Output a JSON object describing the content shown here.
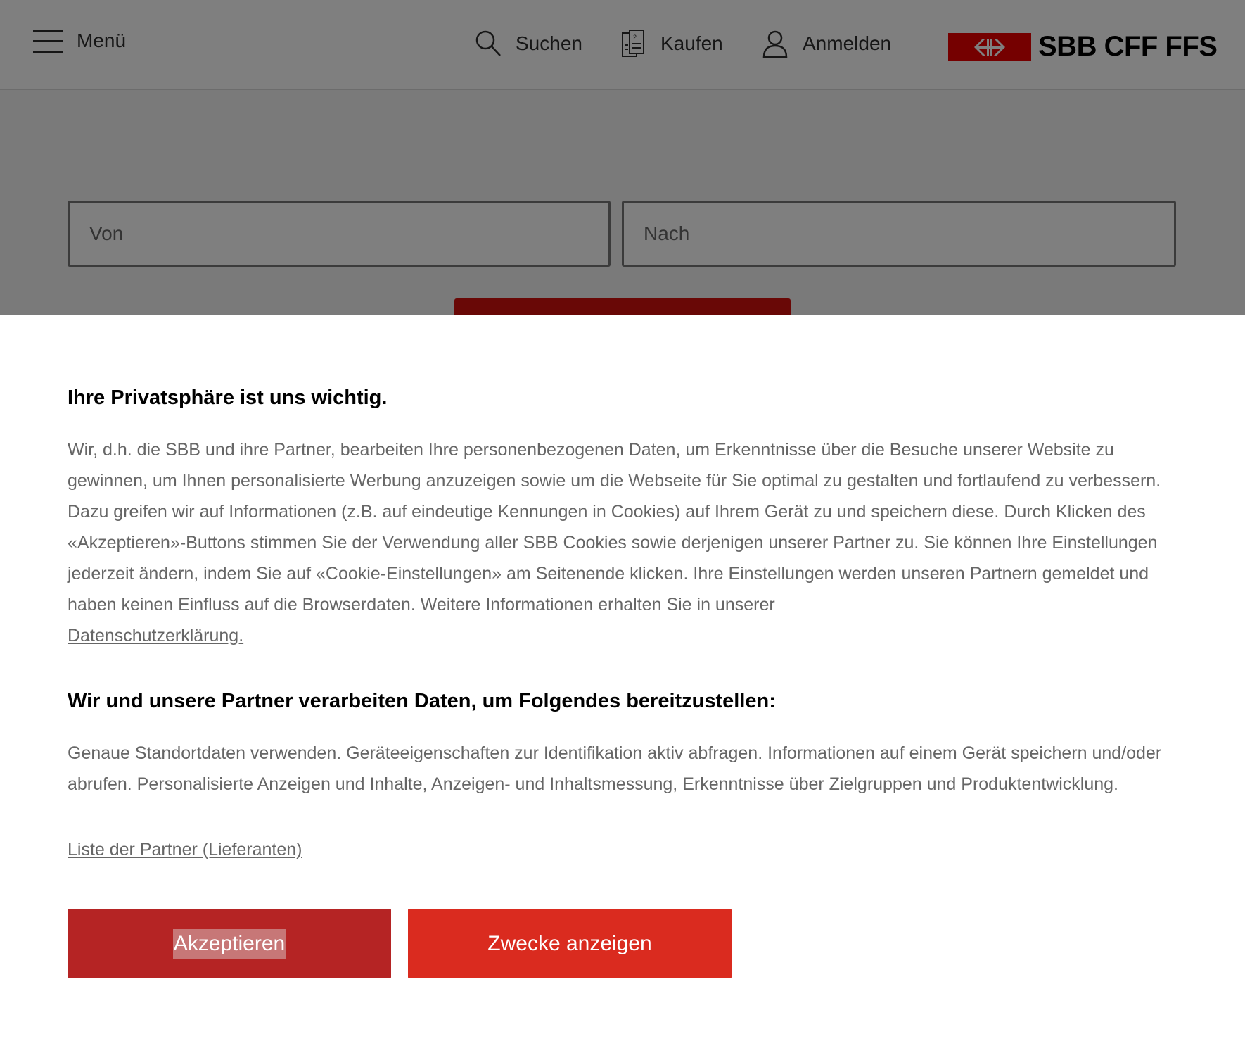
{
  "header": {
    "menu_label": "Menü",
    "nav": {
      "search_label": "Suchen",
      "buy_label": "Kaufen",
      "login_label": "Anmelden"
    },
    "logo_text": "SBB CFF FFS",
    "logo_color": "#eb0000"
  },
  "timetable": {
    "from_placeholder": "Von",
    "to_placeholder": "Nach"
  },
  "consent": {
    "title": "Ihre Privatsphäre ist uns wichtig.",
    "paragraph": "Wir, d.h. die SBB und ihre Partner, bearbeiten Ihre personenbezogenen Daten, um Erkenntnisse über die Besuche unserer Website zu gewinnen, um Ihnen personalisierte Werbung anzuzeigen sowie um die Webseite für Sie optimal zu gestalten und fortlaufend zu verbessern. Dazu greifen wir auf Informationen (z.B. auf eindeutige Kennungen in Cookies) auf Ihrem Gerät zu und speichern diese. Durch Klicken des «Akzeptieren»-Buttons stimmen Sie der Verwendung aller SBB Cookies sowie derjenigen unserer Partner zu. Sie können Ihre Einstellungen jederzeit ändern, indem Sie auf «Cookie-Einstellungen» am Seitenende klicken. Ihre Einstellungen werden unseren Partnern gemeldet und haben keinen Einfluss auf die Browserdaten. Weitere Informationen erhalten Sie in unserer",
    "privacy_link": "Datenschutzerklärung.",
    "purposes_title": "Wir und unsere Partner verarbeiten Daten, um Folgendes bereitzustellen:",
    "purposes_text": "Genaue Standortdaten verwenden. Geräteeigenschaften zur Identifikation aktiv abfragen. Informationen auf einem Gerät speichern und/oder abrufen. Personalisierte Anzeigen und Inhalte, Anzeigen- und Inhaltsmessung, Erkenntnisse über Zielgruppen und Produktentwicklung.",
    "partners_link": "Liste der Partner (Lieferanten)",
    "accept_button": "Akzeptieren",
    "purposes_button": "Zwecke anzeigen",
    "accept_color": "#b52424",
    "purposes_color": "#da2b1f"
  }
}
